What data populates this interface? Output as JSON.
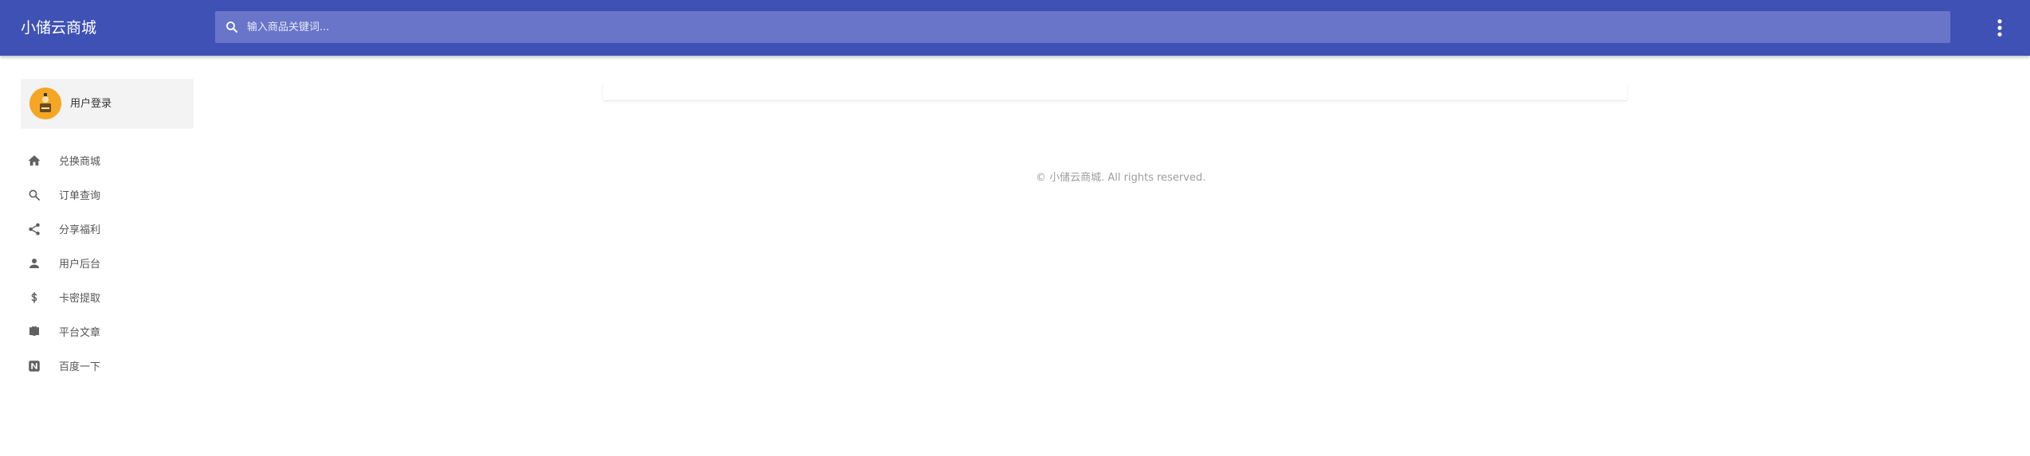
{
  "header": {
    "brand": "小储云商城",
    "search_placeholder": "输入商品关键词...",
    "icons": {
      "search": "search-icon",
      "more": "more-vertical-icon"
    }
  },
  "sidebar": {
    "login_label": "用户登录",
    "items": [
      {
        "label": "兑换商城",
        "icon": "home-icon"
      },
      {
        "label": "订单查询",
        "icon": "search-icon"
      },
      {
        "label": "分享福利",
        "icon": "share-icon"
      },
      {
        "label": "用户后台",
        "icon": "person-icon"
      },
      {
        "label": "卡密提取",
        "icon": "dollar-icon"
      },
      {
        "label": "平台文章",
        "icon": "book-icon"
      },
      {
        "label": "百度一下",
        "icon": "baidu-icon"
      }
    ]
  },
  "footer": {
    "copyright": "© 小储云商城. All rights reserved."
  },
  "colors": {
    "primary": "#3f51b5",
    "search_bg": "#6875c9",
    "avatar": "#f5a623"
  }
}
